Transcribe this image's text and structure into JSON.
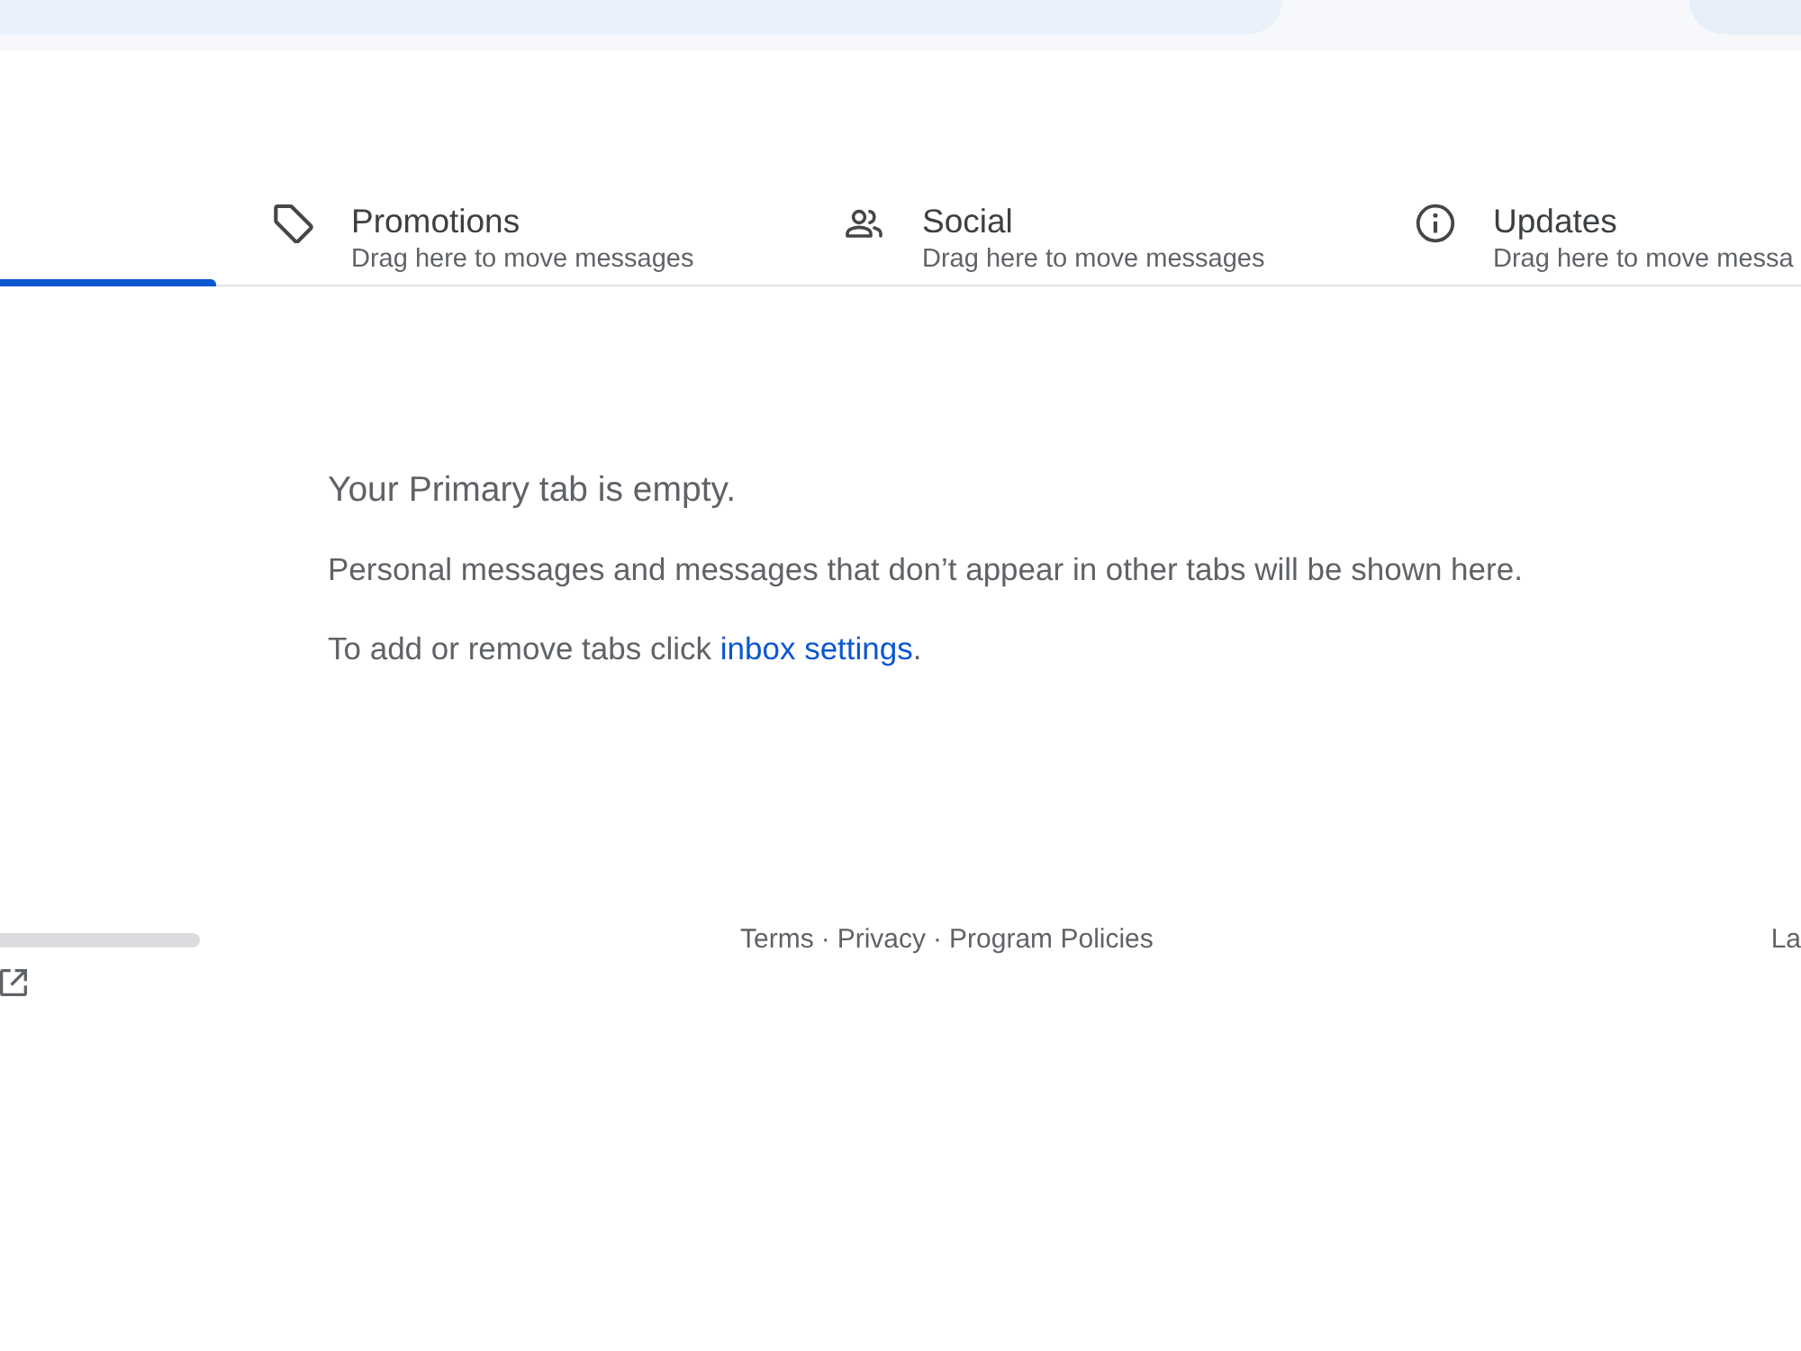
{
  "tabs": [
    {
      "selected": true
    },
    {
      "label": "Promotions",
      "subtitle": "Drag here to move messages",
      "selected": false
    },
    {
      "label": "Social",
      "subtitle": "Drag here to move messages",
      "selected": false
    },
    {
      "label": "Updates",
      "subtitle": "Drag here to move messa",
      "selected": false
    }
  ],
  "empty_state": {
    "title": "Your Primary tab is empty.",
    "message": "Personal messages and messages that don’t appear in other tabs will be shown here.",
    "hint": "To add or remove tabs click",
    "link": "inbox settings",
    "hint_end": "."
  },
  "footer": {
    "links": [
      {
        "label": "Terms",
        "separator": "·"
      },
      {
        "label": "Privacy",
        "separator": "·"
      },
      {
        "label": "Program Policies"
      }
    ],
    "activity": "La"
  }
}
